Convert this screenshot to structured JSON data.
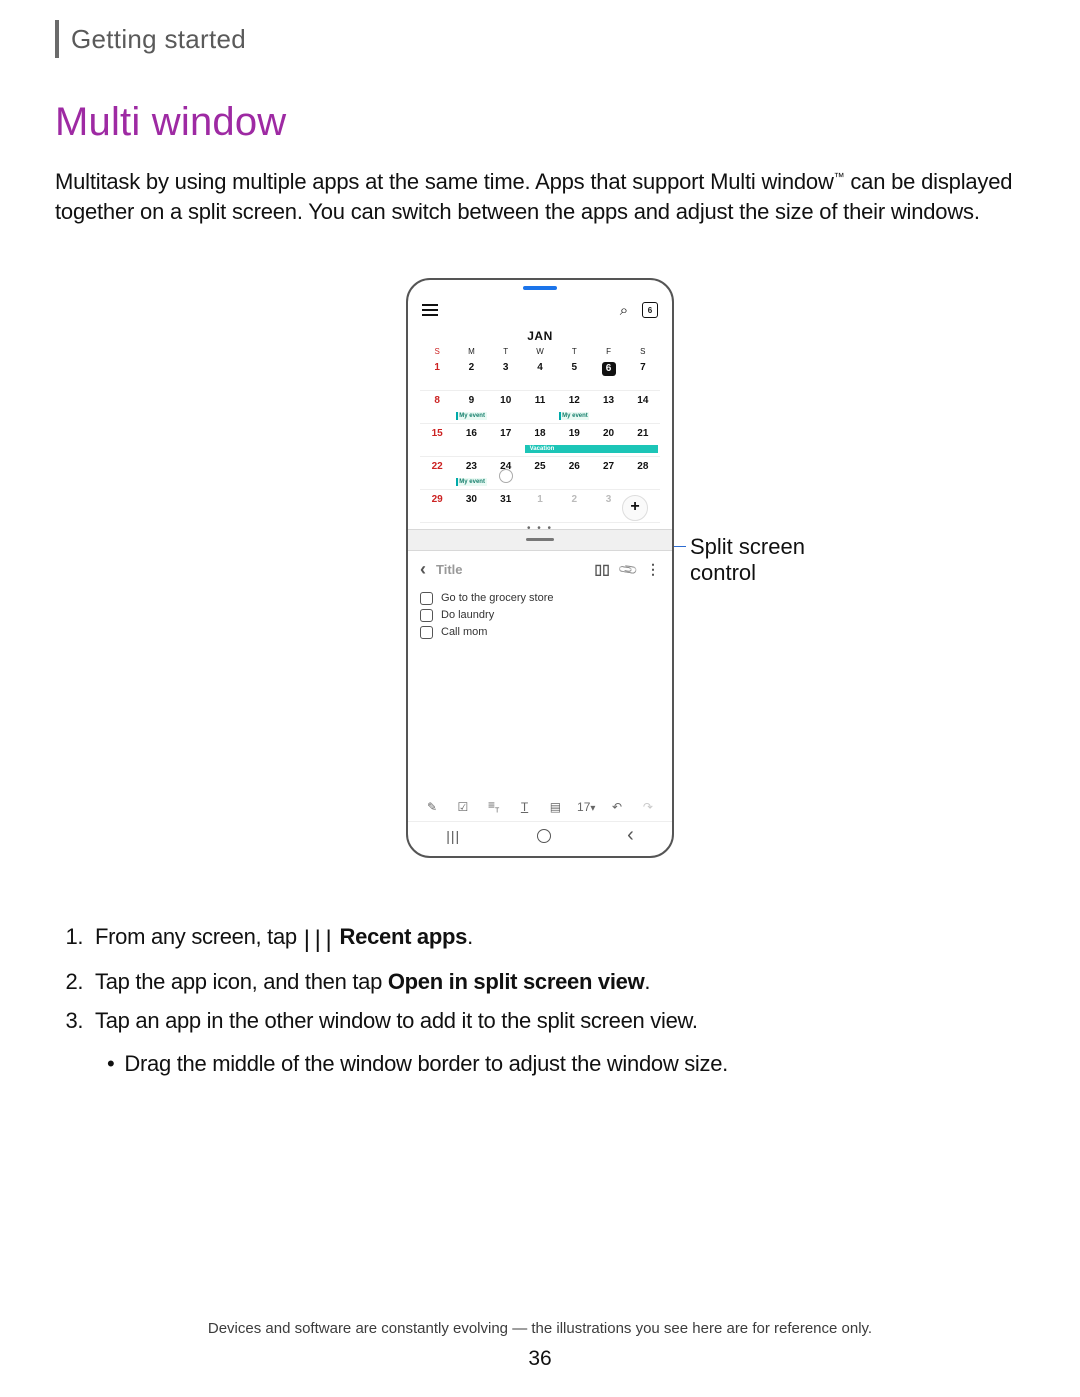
{
  "chapter": "Getting started",
  "heading": "Multi window",
  "intro_before_tm": "Multitask by using multiple apps at the same time. Apps that support Multi window",
  "intro_after_tm": " can be displayed together on a split screen. You can switch between the apps and adjust the size of their windows.",
  "callout_label": "Split screen control",
  "steps": {
    "s1_a": "From any screen, tap",
    "s1_b": "Recent apps",
    "s1_c": ".",
    "s2_a": "Tap the app icon, and then tap ",
    "s2_b": "Open in split screen view",
    "s2_c": ".",
    "s3": "Tap an app in the other window to add it to the split screen view.",
    "s3_bullet": "Drag the middle of the window border to adjust the window size."
  },
  "footnote": "Devices and software are constantly evolving — the illustrations you see here are for reference only.",
  "page_number": "36",
  "phone": {
    "calendar": {
      "badge": "6",
      "month": "JAN",
      "weekdays": [
        "S",
        "M",
        "T",
        "W",
        "T",
        "F",
        "S"
      ],
      "event_label": "My event",
      "vacation_label": "Vacation",
      "rows": [
        [
          "1",
          "2",
          "3",
          "4",
          "5",
          "6",
          "7"
        ],
        [
          "8",
          "9",
          "10",
          "11",
          "12",
          "13",
          "14"
        ],
        [
          "15",
          "16",
          "17",
          "18",
          "19",
          "20",
          "21"
        ],
        [
          "22",
          "23",
          "24",
          "25",
          "26",
          "27",
          "28"
        ],
        [
          "29",
          "30",
          "31",
          "1",
          "2",
          "3",
          ""
        ]
      ]
    },
    "notes": {
      "title_placeholder": "Title",
      "tasks": [
        "Go to the grocery store",
        "Do laundry",
        "Call mom"
      ],
      "font_size_label": "17"
    }
  }
}
